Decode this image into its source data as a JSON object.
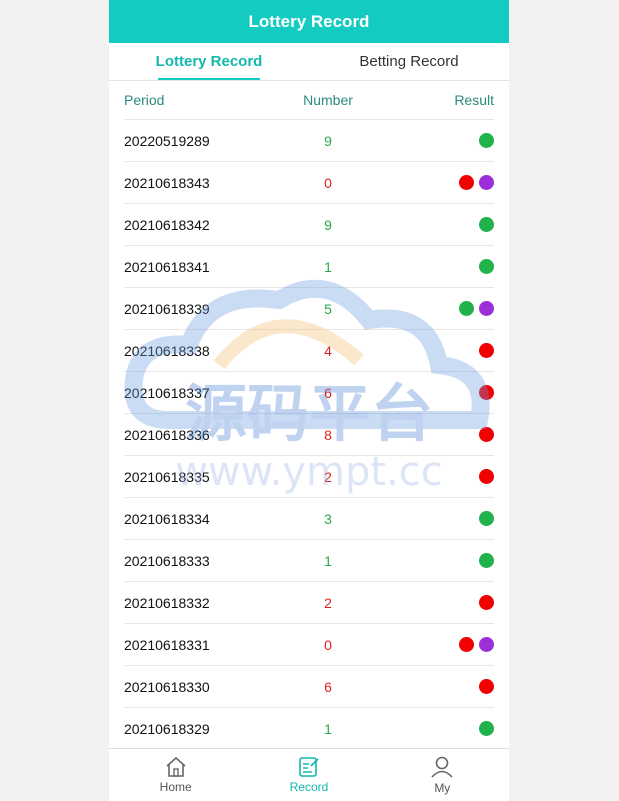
{
  "header": {
    "title": "Lottery Record"
  },
  "tabs": [
    {
      "label": "Lottery Record",
      "active": true
    },
    {
      "label": "Betting Record",
      "active": false
    }
  ],
  "table": {
    "columns": {
      "period": "Period",
      "number": "Number",
      "result": "Result"
    },
    "rows": [
      {
        "period": "20220519289",
        "number": "9",
        "number_color": "#2aa84a",
        "results": [
          "green"
        ]
      },
      {
        "period": "20210618343",
        "number": "0",
        "number_color": "#e02020",
        "results": [
          "red",
          "violet"
        ]
      },
      {
        "period": "20210618342",
        "number": "9",
        "number_color": "#2aa84a",
        "results": [
          "green"
        ]
      },
      {
        "period": "20210618341",
        "number": "1",
        "number_color": "#2aa84a",
        "results": [
          "green"
        ]
      },
      {
        "period": "20210618339",
        "number": "5",
        "number_color": "#2aa84a",
        "results": [
          "green",
          "violet"
        ]
      },
      {
        "period": "20210618338",
        "number": "4",
        "number_color": "#e02020",
        "results": [
          "red"
        ]
      },
      {
        "period": "20210618337",
        "number": "6",
        "number_color": "#e02020",
        "results": [
          "red"
        ]
      },
      {
        "period": "20210618336",
        "number": "8",
        "number_color": "#e02020",
        "results": [
          "red"
        ]
      },
      {
        "period": "20210618335",
        "number": "2",
        "number_color": "#e02020",
        "results": [
          "red"
        ]
      },
      {
        "period": "20210618334",
        "number": "3",
        "number_color": "#2aa84a",
        "results": [
          "green"
        ]
      },
      {
        "period": "20210618333",
        "number": "1",
        "number_color": "#2aa84a",
        "results": [
          "green"
        ]
      },
      {
        "period": "20210618332",
        "number": "2",
        "number_color": "#e02020",
        "results": [
          "red"
        ]
      },
      {
        "period": "20210618331",
        "number": "0",
        "number_color": "#e02020",
        "results": [
          "red",
          "violet"
        ]
      },
      {
        "period": "20210618330",
        "number": "6",
        "number_color": "#e02020",
        "results": [
          "red"
        ]
      },
      {
        "period": "20210618329",
        "number": "1",
        "number_color": "#2aa84a",
        "results": [
          "green"
        ]
      }
    ]
  },
  "dot_colors": {
    "green": "#22b24c",
    "red": "#f00000",
    "violet": "#9b30d9"
  },
  "watermark": {
    "line1": "源码平台",
    "line2": "www.ympt.cc"
  },
  "bottom_nav": [
    {
      "label": "Home",
      "icon": "home-icon",
      "active": false
    },
    {
      "label": "Record",
      "icon": "record-icon",
      "active": true
    },
    {
      "label": "My",
      "icon": "user-icon",
      "active": false
    }
  ],
  "colors": {
    "accent": "#13cbc0",
    "header_text": "#2a8a7f"
  }
}
